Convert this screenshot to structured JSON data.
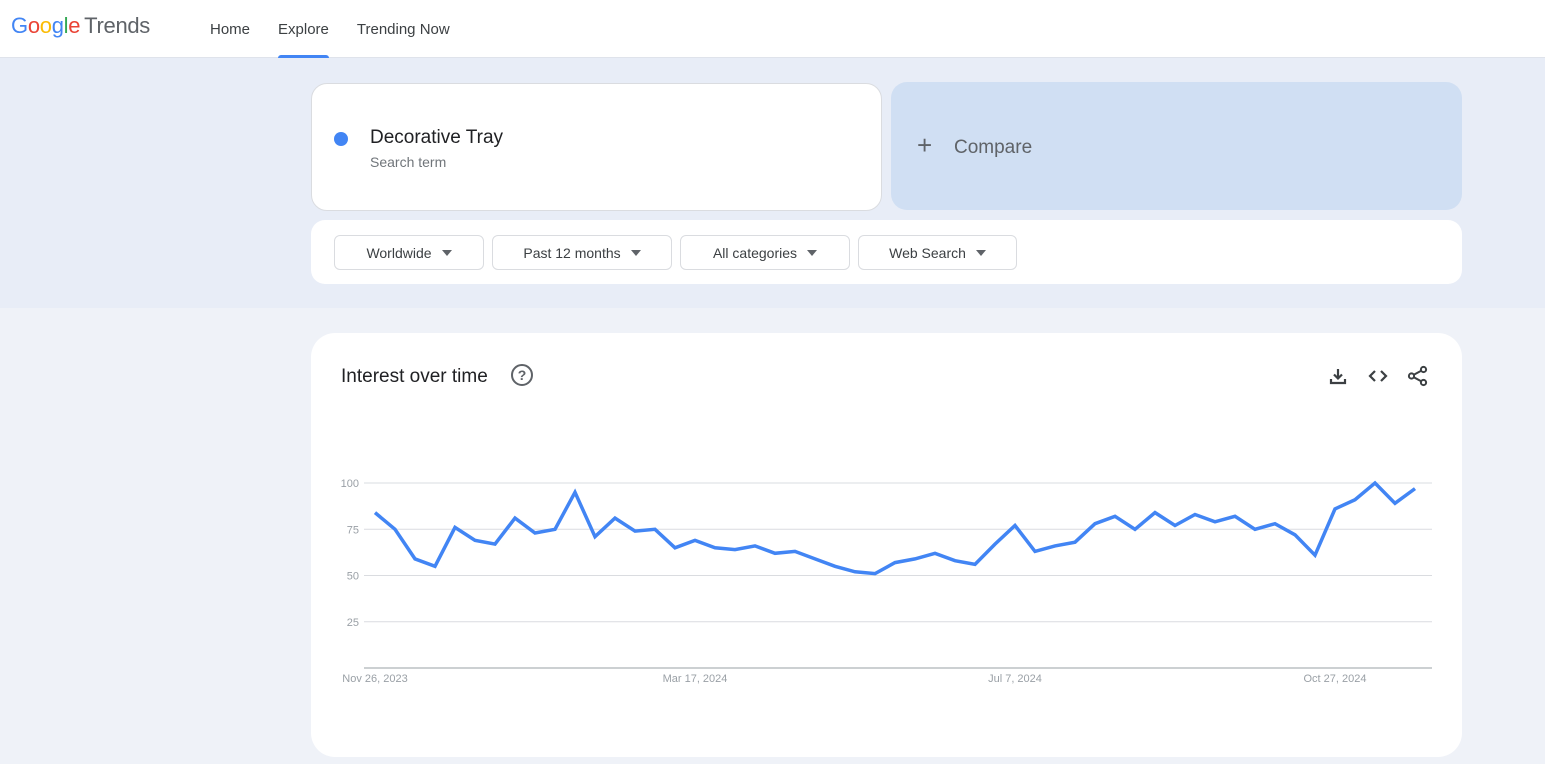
{
  "app": {
    "logo_parts": [
      "G",
      "o",
      "o",
      "g",
      "l",
      "e"
    ],
    "logo_suffix": "Trends"
  },
  "nav": {
    "items": [
      {
        "label": "Home",
        "active": false
      },
      {
        "label": "Explore",
        "active": true
      },
      {
        "label": "Trending Now",
        "active": false
      }
    ]
  },
  "search": {
    "term": "Decorative Tray",
    "term_type": "Search term",
    "term_color": "#4285f4",
    "compare_label": "Compare",
    "compare_icon": "plus-icon"
  },
  "filters": [
    {
      "label": "Worldwide",
      "icon": "caret-down-icon"
    },
    {
      "label": "Past 12 months",
      "icon": "caret-down-icon"
    },
    {
      "label": "All categories",
      "icon": "caret-down-icon"
    },
    {
      "label": "Web Search",
      "icon": "caret-down-icon"
    }
  ],
  "chart_card": {
    "title": "Interest over time",
    "help_icon": "?",
    "actions": [
      {
        "name": "download",
        "icon": "download-icon"
      },
      {
        "name": "embed",
        "icon": "code-icon"
      },
      {
        "name": "share",
        "icon": "share-icon"
      }
    ]
  },
  "chart_data": {
    "type": "line",
    "title": "Interest over time",
    "xlabel": "",
    "ylabel": "",
    "ylim": [
      0,
      100
    ],
    "y_ticks": [
      25,
      50,
      75,
      100
    ],
    "x_tick_labels": [
      {
        "label": "Nov 26, 2023",
        "index": 0
      },
      {
        "label": "Mar 17, 2024",
        "index": 16
      },
      {
        "label": "Jul 7, 2024",
        "index": 32
      },
      {
        "label": "Oct 27, 2024",
        "index": 48
      }
    ],
    "grid": true,
    "series": [
      {
        "name": "Decorative Tray",
        "color": "#4285f4",
        "values": [
          84,
          75,
          59,
          55,
          76,
          69,
          67,
          81,
          73,
          75,
          95,
          71,
          81,
          74,
          75,
          65,
          69,
          65,
          64,
          66,
          62,
          63,
          59,
          55,
          52,
          51,
          57,
          59,
          62,
          58,
          56,
          67,
          77,
          63,
          66,
          68,
          78,
          82,
          75,
          84,
          77,
          83,
          79,
          82,
          75,
          78,
          72,
          61,
          86,
          91,
          100,
          89,
          97
        ]
      }
    ]
  }
}
